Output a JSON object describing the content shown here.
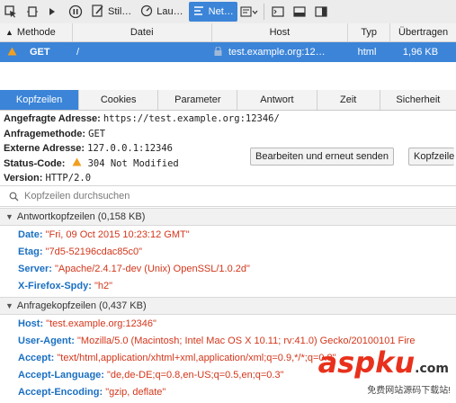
{
  "toolbar": {
    "tabs": [
      {
        "label": "Stil…",
        "icon": "style-editor-icon"
      },
      {
        "label": "Lau…",
        "icon": "performance-icon"
      },
      {
        "label": "Net…",
        "icon": "network-icon",
        "active": true
      }
    ]
  },
  "table": {
    "headers": [
      "Methode",
      "Datei",
      "Host",
      "Typ",
      "Übertragen"
    ],
    "row": {
      "status_icon": "warning-icon",
      "method": "GET",
      "file": "/",
      "host": "test.example.org:12…",
      "type": "html",
      "transferred": "1,96 KB"
    }
  },
  "tabs": [
    "Kopfzeilen",
    "Cookies",
    "Parameter",
    "Antwort",
    "Zeit",
    "Sicherheit"
  ],
  "summary": {
    "address_label": "Angefragte Adresse:",
    "address_value": "https://test.example.org:12346/",
    "method_label": "Anfragemethode:",
    "method_value": "GET",
    "remote_label": "Externe Adresse:",
    "remote_value": "127.0.0.1:12346",
    "status_label": "Status-Code:",
    "status_value": "304 Not Modified",
    "version_label": "Version:",
    "version_value": "HTTP/2.0"
  },
  "buttons": {
    "edit_resend": "Bearbeiten und erneut senden",
    "raw_headers": "Kopfzeile"
  },
  "filter": {
    "placeholder": "Kopfzeilen durchsuchen"
  },
  "response_section": {
    "title": "Antwortkopfzeilen (0,158 KB)",
    "headers": [
      {
        "name": "Date:",
        "value": "\"Fri, 09 Oct 2015 10:23:12 GMT\""
      },
      {
        "name": "Etag:",
        "value": "\"7d5-52196cdac85c0\""
      },
      {
        "name": "Server:",
        "value": "\"Apache/2.4.17-dev (Unix) OpenSSL/1.0.2d\""
      },
      {
        "name": "X-Firefox-Spdy:",
        "value": "\"h2\""
      }
    ]
  },
  "request_section": {
    "title": "Anfragekopfzeilen (0,437 KB)",
    "headers": [
      {
        "name": "Host:",
        "value": "\"test.example.org:12346\""
      },
      {
        "name": "User-Agent:",
        "value": "\"Mozilla/5.0 (Macintosh; Intel Mac OS X 10.11; rv:41.0) Gecko/20100101 Fire"
      },
      {
        "name": "Accept:",
        "value": "\"text/html,application/xhtml+xml,application/xml;q=0.9,*/*;q=0.8\""
      },
      {
        "name": "Accept-Language:",
        "value": "\"de,de-DE;q=0.8,en-US;q=0.5,en;q=0.3\""
      },
      {
        "name": "Accept-Encoding:",
        "value": "\"gzip, deflate\""
      }
    ]
  },
  "watermark": {
    "logo": "aspku",
    "tld": ".com",
    "tagline": "免费网站源码下载站!"
  }
}
